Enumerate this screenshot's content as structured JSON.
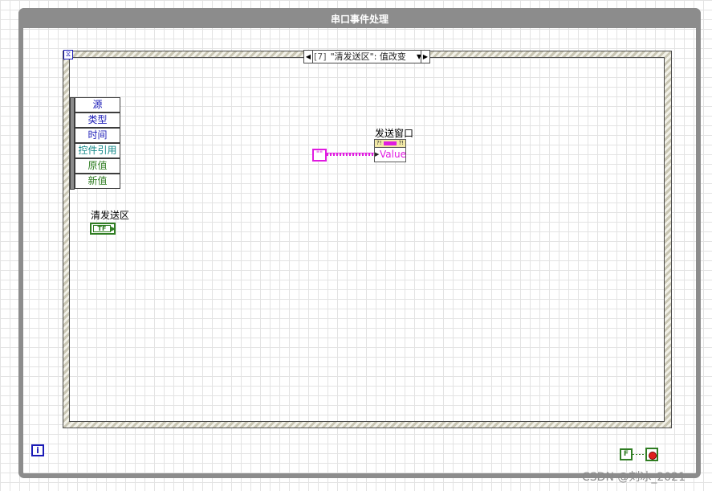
{
  "while_loop": {
    "title": "串口事件处理"
  },
  "event_structure": {
    "timeout_icon": "hourglass-icon",
    "case_selector": {
      "index": "[7]",
      "label": "\"清发送区\": 值改变"
    },
    "event_data_node": {
      "items": [
        {
          "label": "源",
          "color": "#1b1bb7"
        },
        {
          "label": "类型",
          "color": "#1b1bb7"
        },
        {
          "label": "时间",
          "color": "#1b1bb7"
        },
        {
          "label": "控件引用",
          "color": "#168a8a"
        },
        {
          "label": "原值",
          "color": "#2f7d22"
        },
        {
          "label": "新值",
          "color": "#2f7d22"
        }
      ]
    },
    "boolean_terminal": {
      "label": "清发送区",
      "text": "TF"
    },
    "string_constant": {
      "text": "\"\""
    },
    "property_node": {
      "label": "发送窗口",
      "property": "Value"
    }
  },
  "iteration_terminal": {
    "text": "i"
  },
  "false_constant": {
    "text": "F"
  },
  "watermark": "CSDN @刘冰_2021",
  "colors": {
    "loop_frame": "#8c8c8c",
    "string_wire": "#e01be0",
    "boolean": "#2f7d22",
    "numeric_blue": "#1b1bb7"
  }
}
